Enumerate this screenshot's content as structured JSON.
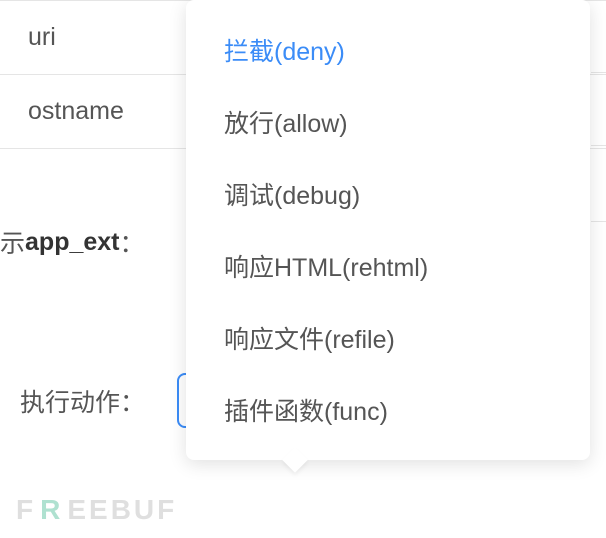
{
  "table": {
    "rows": [
      {
        "label": "uri"
      },
      {
        "label": "ostname"
      }
    ]
  },
  "app_ext": {
    "prefix": "示",
    "bold": "app_ext",
    "colon": "："
  },
  "action": {
    "label": "执行动作：",
    "selected": "拦截(deny)"
  },
  "dropdown": {
    "options": [
      {
        "label": "拦截(deny)",
        "selected": true
      },
      {
        "label": "放行(allow)",
        "selected": false
      },
      {
        "label": "调试(debug)",
        "selected": false
      },
      {
        "label": "响应HTML(rehtml)",
        "selected": false
      },
      {
        "label": "响应文件(refile)",
        "selected": false
      },
      {
        "label": "插件函数(func)",
        "selected": false
      }
    ]
  },
  "watermark": {
    "text1": "F",
    "accent": "R",
    "text2": "EEBUF"
  }
}
